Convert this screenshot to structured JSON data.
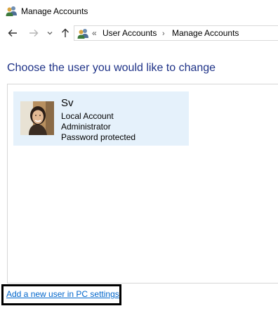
{
  "window": {
    "title": "Manage Accounts",
    "icon": "users-icon"
  },
  "nav": {
    "back_icon": "arrow-left-icon",
    "forward_icon": "arrow-right-icon",
    "recent_icon": "chevron-down-icon",
    "up_icon": "arrow-up-icon"
  },
  "address": {
    "icon": "users-icon",
    "overflow": "«",
    "crumbs": [
      "User Accounts",
      "Manage Accounts"
    ],
    "separator": "›"
  },
  "main": {
    "heading": "Choose the user you would like to change",
    "users": [
      {
        "name": "Sv",
        "type": "Local Account",
        "role": "Administrator",
        "security": "Password protected",
        "avatar": "user-photo"
      }
    ],
    "add_user_link": "Add a new user in PC settings"
  },
  "colors": {
    "heading": "#1e3287",
    "tile_background": "#e5f1fb",
    "link": "#0066cc"
  }
}
